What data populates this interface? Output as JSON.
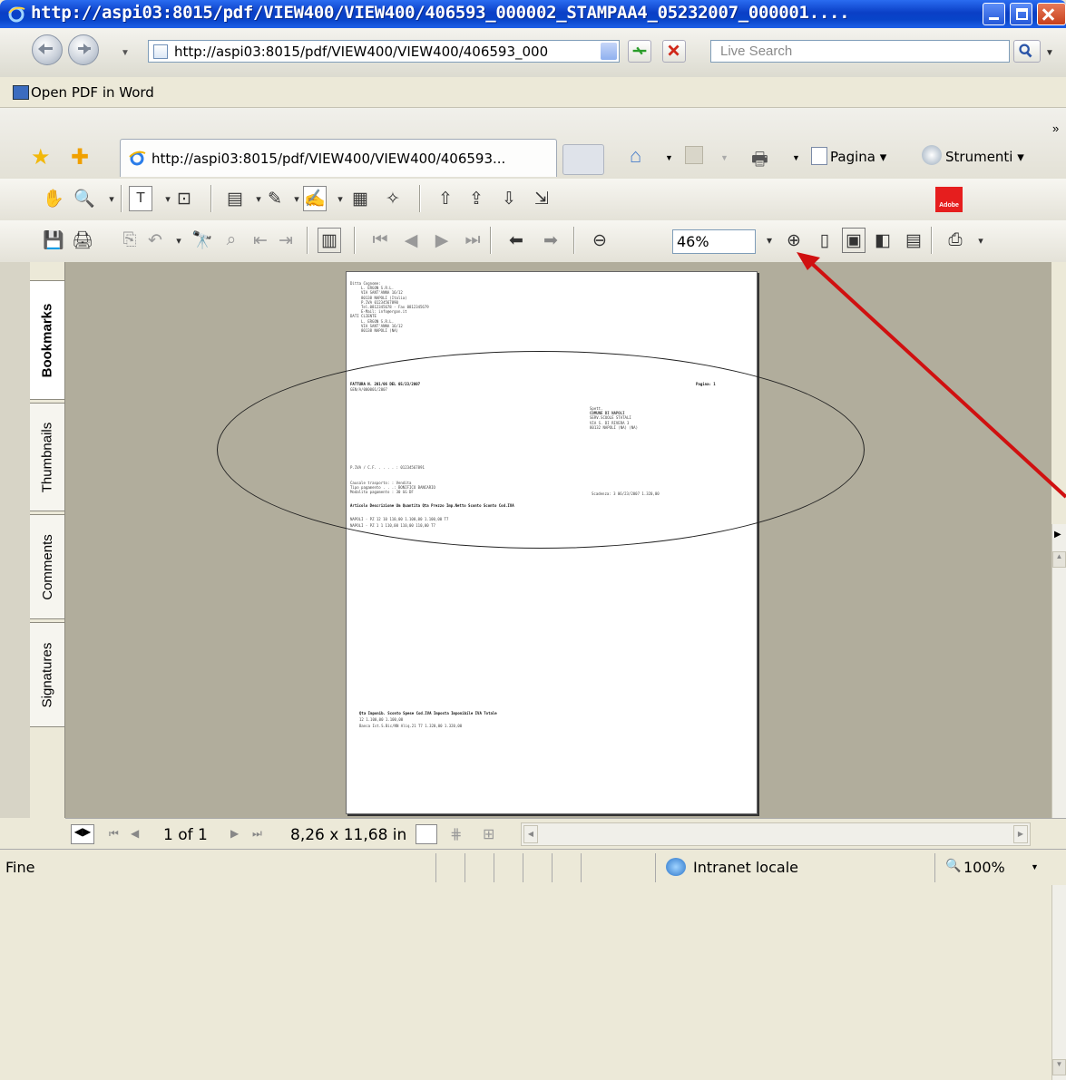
{
  "window": {
    "title": "http://aspi03:8015/pdf/VIEW400/VIEW400/406593_000002_STAMPAA4_05232007_000001...."
  },
  "address_bar": {
    "url": "http://aspi03:8015/pdf/VIEW400/VIEW400/406593_000",
    "search_placeholder": "Live Search"
  },
  "menu": {
    "open_pdf_in_word": "Open PDF in Word"
  },
  "tabs": [
    {
      "label": "http://aspi03:8015/pdf/VIEW400/VIEW400/406593..."
    }
  ],
  "commands": {
    "page": "Pagina",
    "tools": "Strumenti"
  },
  "pdf_toolbar": {
    "zoom": "46%",
    "adobe_label": "Adobe"
  },
  "side_tabs": [
    "Bookmarks",
    "Thumbnails",
    "Comments",
    "Signatures"
  ],
  "bottom_nav": {
    "page_indicator": "1 of 1",
    "page_size": "8,26 x 11,68 in"
  },
  "status": {
    "text": "Fine",
    "zone": "Intranet locale",
    "zoom": "100%"
  },
  "document": {
    "header_lines": [
      "Ditta Cognome:",
      "L. ERGON S.R.L.",
      "VIA SANT'ANNA 16/12",
      "80138 NAPOLI (Italia)",
      "P.IVA 01234567890",
      "Tel.0812345678 - Fax 0812345679",
      "E-Mail: info@ergon.it",
      "DATI CLIENTE",
      "L. ERGON S.R.L.",
      "VIA SANT'ANNA 16/12",
      "80138 NAPOLI (NA)"
    ],
    "invoice_title": "FATTURA N. 201/06 DEL 05/23/2007",
    "invoice_sub": "GEN/A/000001/2007",
    "page_label": "Pagina: 1",
    "dest_lines": [
      "Spett.",
      "COMUNE DI NAPOLI",
      "SERV.SCUOLE STATALI",
      "VIA S. DI RIVERA 3",
      "80132 NAPOLI (NA) (NA)"
    ],
    "piva_line": "P.IVA / C.F. . . . . : 01234567891",
    "pay_lines": [
      "Causale trasporto: : Vendita",
      "Tipo pagamento . . .: BONIFICO BANCARIO",
      "Modalita pagamento : 30 GG DF"
    ],
    "scadenza": "Scadenza: 3 06/23/2007 1.320,00",
    "table_header": "Articolo         Descrizione     Um  Quantita    Qta    Prezzo  Imp.Netto  Sconto Sconto  Cod.IVA",
    "table_rows": [
      "NAPOLI           -               PZ   12        10   110,00   1.100,00          1.100,00 T7",
      "NAPOLI           -               PZ    1         1   110,00     110,00            110,00 T7"
    ],
    "footer_header": "Qta    Imponib.    Sconto  Spese  Cod.IVA    Imposta     Imponibile     IVA        Totale",
    "footer_row1": " 12    1.100,00    1.100,00",
    "footer_row2": "       Banca  Ist.S.Bic/NN  Aliq.21     T7   1.320,00                               1.320,00"
  }
}
